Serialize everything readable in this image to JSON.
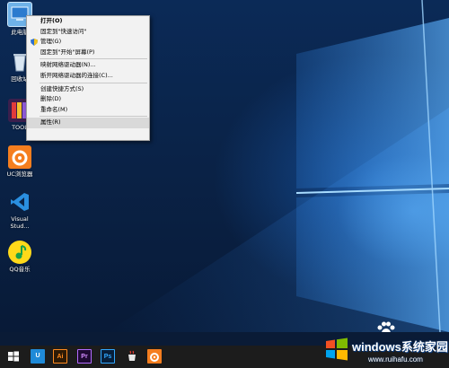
{
  "desktop_icons": [
    {
      "label": "此电脑"
    },
    {
      "label": "回收站"
    },
    {
      "label": "TOOL"
    },
    {
      "label": "UC浏览器"
    },
    {
      "label": "Visual\nStud..."
    },
    {
      "label": "QQ音乐"
    }
  ],
  "context_menu": {
    "items": [
      {
        "label": "打开(O)"
      },
      {
        "label": "固定到\"快速访问\""
      },
      {
        "label": "管理(G)"
      },
      {
        "label": "固定到\"开始\"屏幕(P)"
      },
      {
        "label": "映射网络驱动器(N)..."
      },
      {
        "label": "断开网络驱动器的连接(C)..."
      },
      {
        "label": "创建快捷方式(S)"
      },
      {
        "label": "删除(D)"
      },
      {
        "label": "重命名(M)"
      },
      {
        "label": "属性(R)"
      }
    ]
  },
  "taskbar": {
    "apps": [
      {
        "icon": "windows-start-icon"
      },
      {
        "icon": "u-app-icon",
        "text": "U"
      },
      {
        "icon": "illustrator-icon",
        "text": "Ai"
      },
      {
        "icon": "premiere-icon",
        "text": "Pr"
      },
      {
        "icon": "photoshop-icon",
        "text": "Ps"
      },
      {
        "icon": "coffee-app-icon"
      },
      {
        "icon": "uc-browser-icon"
      }
    ]
  },
  "watermark": {
    "title": "windows系统家园",
    "url": "www.ruihafu.com"
  },
  "colors": {
    "accent": "#1e6ed2",
    "menu_bg": "#f2f2f2",
    "taskbar": "#1c1c1c"
  }
}
